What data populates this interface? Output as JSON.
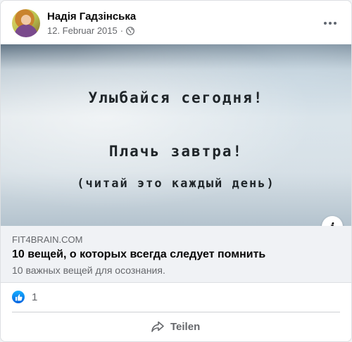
{
  "post": {
    "author": "Надія Гадзінська",
    "date": "12. Februar 2015",
    "separator": "·"
  },
  "image": {
    "line1": "Улыбайся сегодня!",
    "line2": "Плачь завтра!",
    "line3": "(читай это каждый день)"
  },
  "link": {
    "domain": "FIT4BRAIN.COM",
    "title": "10 вещей, о которых всегда следует помнить",
    "description": "10 важных вещей для осознания."
  },
  "reactions": {
    "count": "1"
  },
  "actions": {
    "share_label": "Teilen"
  },
  "icons": {
    "privacy": "globe-icon",
    "more": "more-options-icon",
    "info": "info-icon",
    "like": "like-icon",
    "share": "share-arrow-icon"
  },
  "colors": {
    "like_blue": "#0866ff",
    "text_primary": "#050505",
    "text_secondary": "#65676b"
  }
}
